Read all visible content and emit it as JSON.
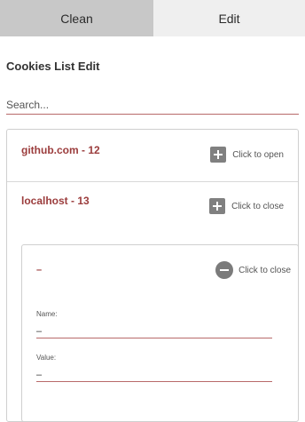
{
  "tabs": {
    "clean_label": "Clean",
    "edit_label": "Edit"
  },
  "page_title": "Cookies List Edit",
  "search": {
    "placeholder": "Search...",
    "value": ""
  },
  "domains": [
    {
      "label": "github.com - 12",
      "action_label": "Click to open",
      "icon": "plus-icon"
    },
    {
      "label": "localhost - 13",
      "action_label": "Click to close",
      "icon": "plus-icon"
    }
  ],
  "cookie": {
    "name": "–",
    "action_label": "Click to close",
    "icon": "minus-circle-icon",
    "name_field_label": "Name:",
    "name_field_value": "–",
    "value_field_label": "Value:",
    "value_field_value": "–"
  },
  "colors": {
    "accent": "#9b3c3c",
    "underline": "#b86a6a",
    "tab_active": "#c8c8c8",
    "tab_inactive": "#efefef"
  }
}
